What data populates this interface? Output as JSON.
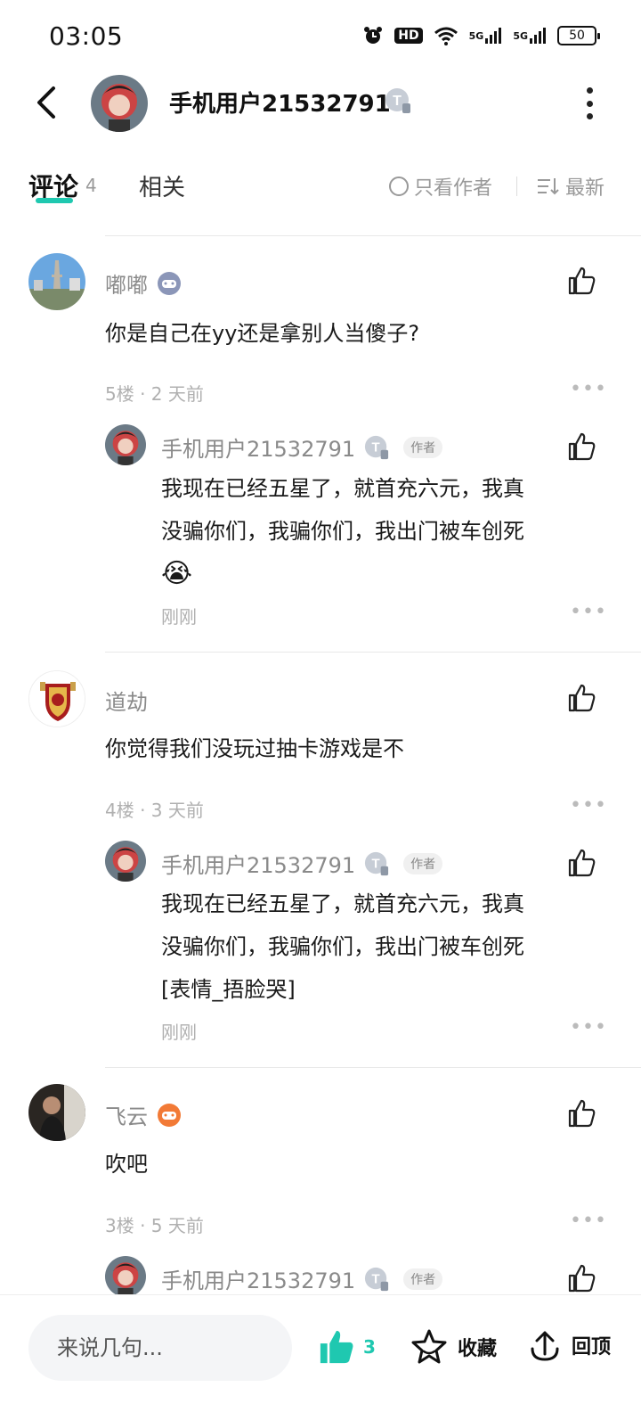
{
  "status_bar": {
    "time": "03:05",
    "signal_1": "5G",
    "signal_2": "5G",
    "hd_label": "HD",
    "battery": "50"
  },
  "header": {
    "username": "手机用户21532791",
    "badge": "T"
  },
  "tabs": {
    "comments_label": "评论",
    "comments_count": "4",
    "related_label": "相关",
    "author_only_label": "只看作者",
    "sort_label": "最新"
  },
  "comments": [
    {
      "username": "嘟嘟",
      "content": "你是自己在yy还是拿别人当傻子?",
      "meta": "5楼 · 2 天前",
      "reply": {
        "username": "手机用户21532791",
        "author_tag": "作者",
        "line1": "我现在已经五星了，就首充六元，我真",
        "line2": "没骗你们，我骗你们，我出门被车创死",
        "emoji": "😭",
        "time": "刚刚"
      }
    },
    {
      "username": "道劫",
      "content": "你觉得我们没玩过抽卡游戏是不",
      "meta": "4楼 · 3 天前",
      "reply": {
        "username": "手机用户21532791",
        "author_tag": "作者",
        "line1": "我现在已经五星了，就首充六元，我真",
        "line2": "没骗你们，我骗你们，我出门被车创死",
        "line3": "[表情_捂脸哭]",
        "time": "刚刚"
      }
    },
    {
      "username": "飞云",
      "content": "吹吧",
      "meta": "3楼 · 5 天前",
      "reply": {
        "username": "手机用户21532791",
        "author_tag": "作者"
      }
    }
  ],
  "bottom_bar": {
    "input_placeholder": "来说几句...",
    "like_count": "3",
    "collect_label": "收藏",
    "totop_label": "回顶"
  },
  "colors": {
    "accent": "#1fc8b0",
    "muted_text": "#8a8a8a",
    "meta_text": "#b0b0b0"
  }
}
